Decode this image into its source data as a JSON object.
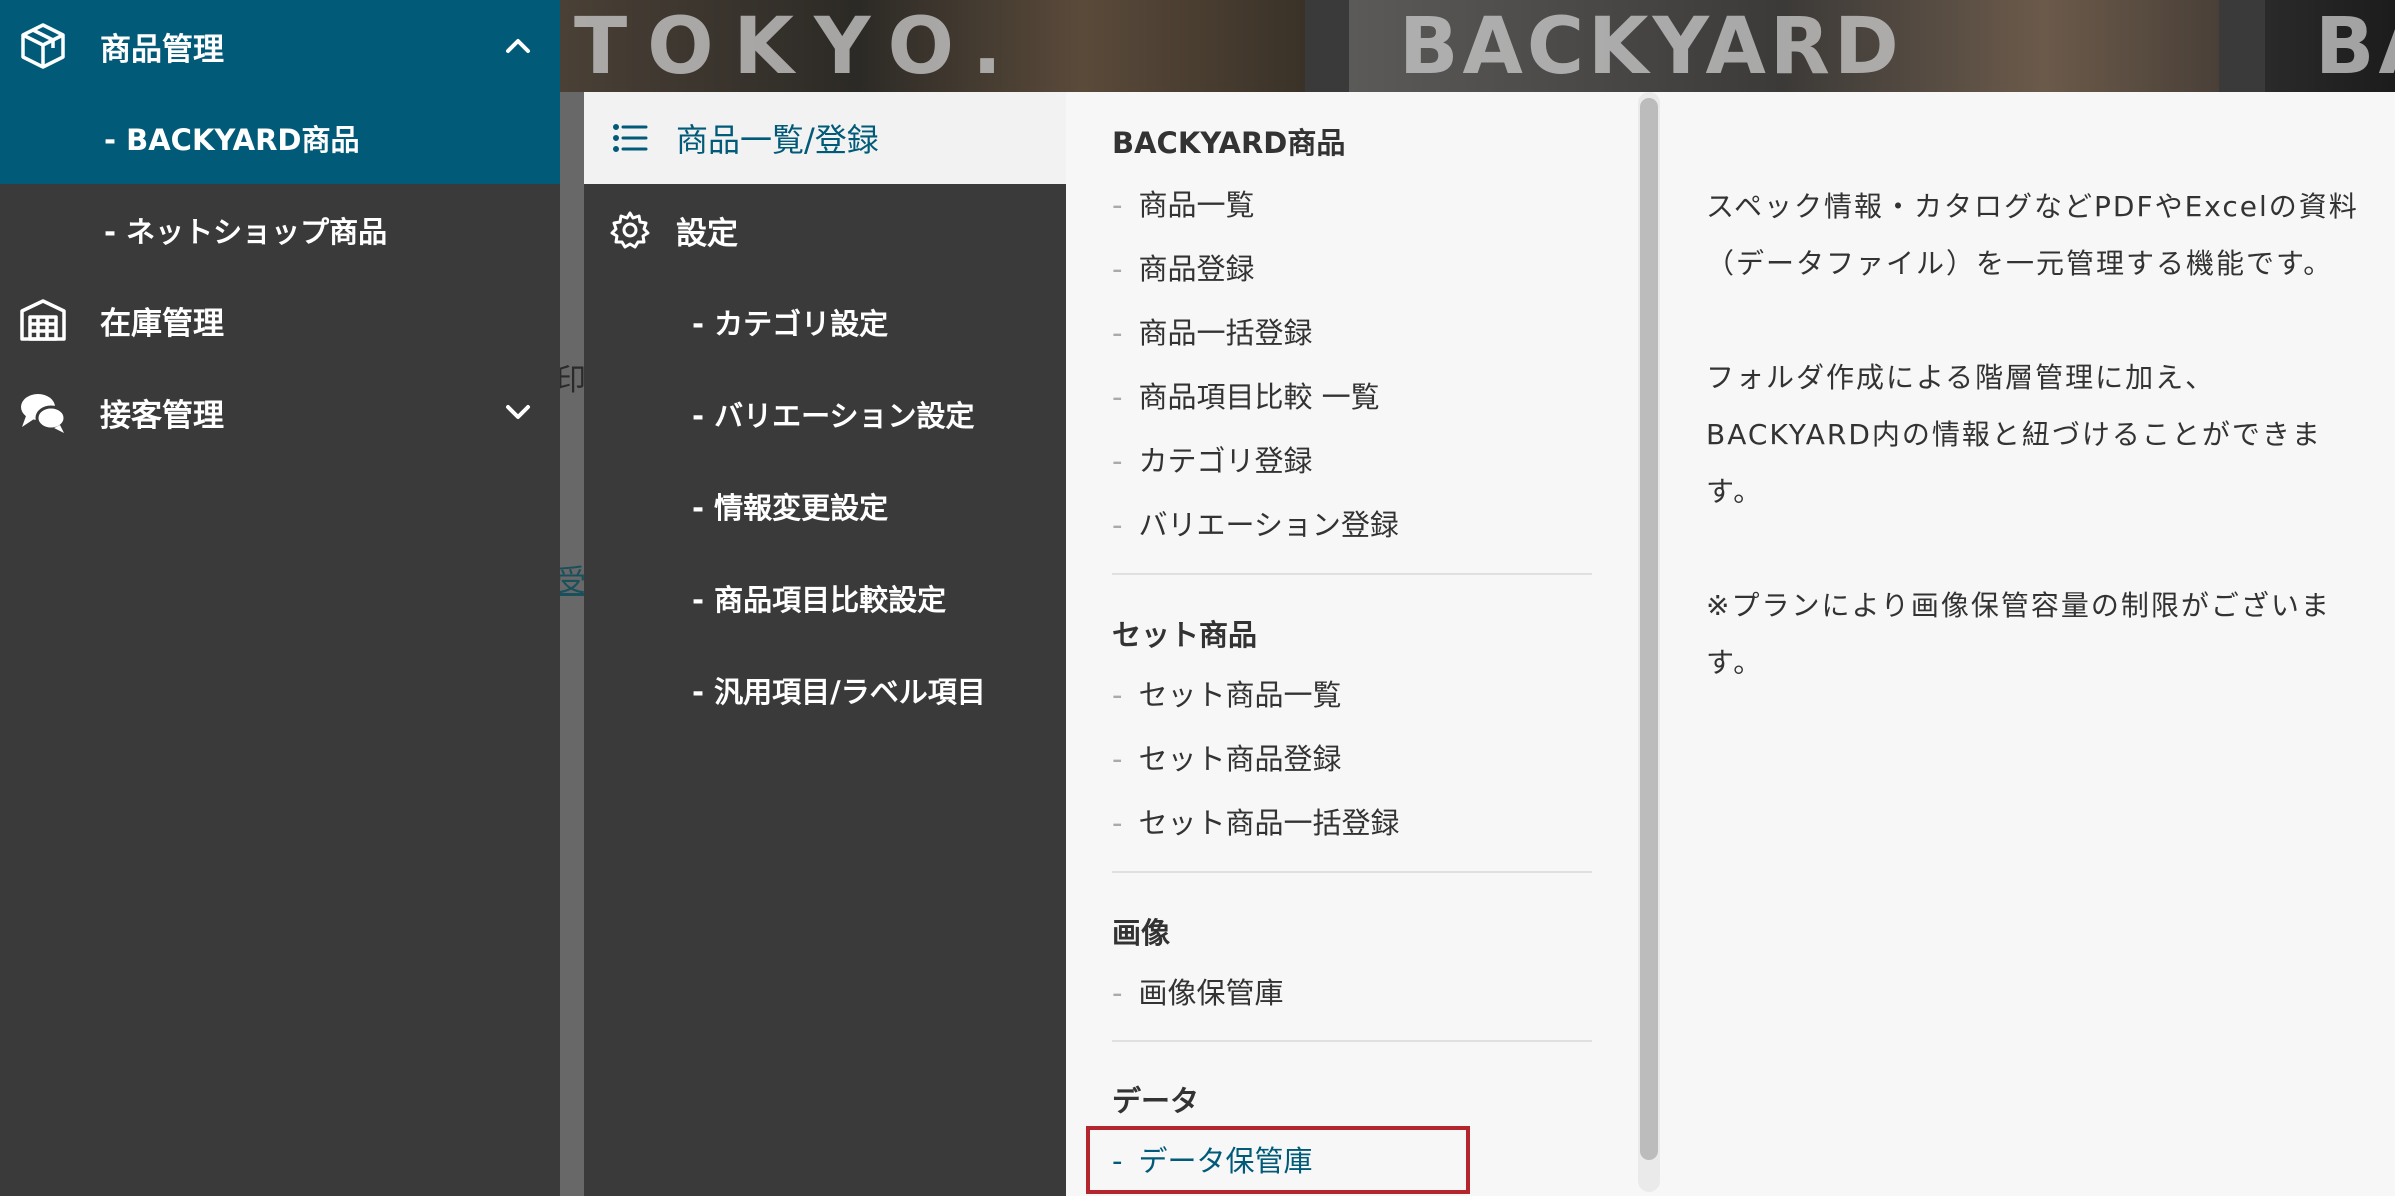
{
  "background": {
    "banners": [
      "TOKYO.",
      "BACKYARD",
      "BA"
    ],
    "fragments": [
      "印",
      "受"
    ]
  },
  "sidebar": {
    "items": [
      {
        "label": "商品管理",
        "icon": "package-icon",
        "expanded": true
      },
      {
        "label": "在庫管理",
        "icon": "warehouse-icon"
      },
      {
        "label": "接客管理",
        "icon": "chat-bubbles-icon",
        "expanded": false
      }
    ],
    "sub_items": [
      "- BACKYARD商品",
      "- ネットショップ商品"
    ]
  },
  "submenu": {
    "top_label": "商品一覧/登録",
    "settings_label": "設定",
    "settings_items": [
      "- カテゴリ設定",
      "- バリエーション設定",
      "- 情報変更設定",
      "- 商品項目比較設定",
      "- 汎用項目/ラベル項目"
    ]
  },
  "panel": {
    "groups": [
      {
        "title": "BACKYARD商品",
        "links": [
          "商品一覧",
          "商品登録",
          "商品一括登録",
          "商品項目比較 一覧",
          "カテゴリ登録",
          "バリエーション登録"
        ]
      },
      {
        "title": "セット商品",
        "links": [
          "セット商品一覧",
          "セット商品登録",
          "セット商品一括登録"
        ]
      },
      {
        "title": "画像",
        "links": [
          "画像保管庫"
        ]
      },
      {
        "title": "データ",
        "links": [
          "データ保管庫"
        ]
      }
    ],
    "description": [
      "スペック情報・カタログなどPDFやExcelの資料（データファイル）を一元管理する機能です。",
      "フォルダ作成による階層管理に加え、BACKYARD内の情報と紐づけることができます。",
      "※プランにより画像保管容量の制限がございます。"
    ]
  },
  "colors": {
    "accent": "#005a78",
    "sidebar_bg": "#3a3a3a",
    "panel_bg": "#f7f7f7",
    "highlight_border": "#b5252e"
  }
}
